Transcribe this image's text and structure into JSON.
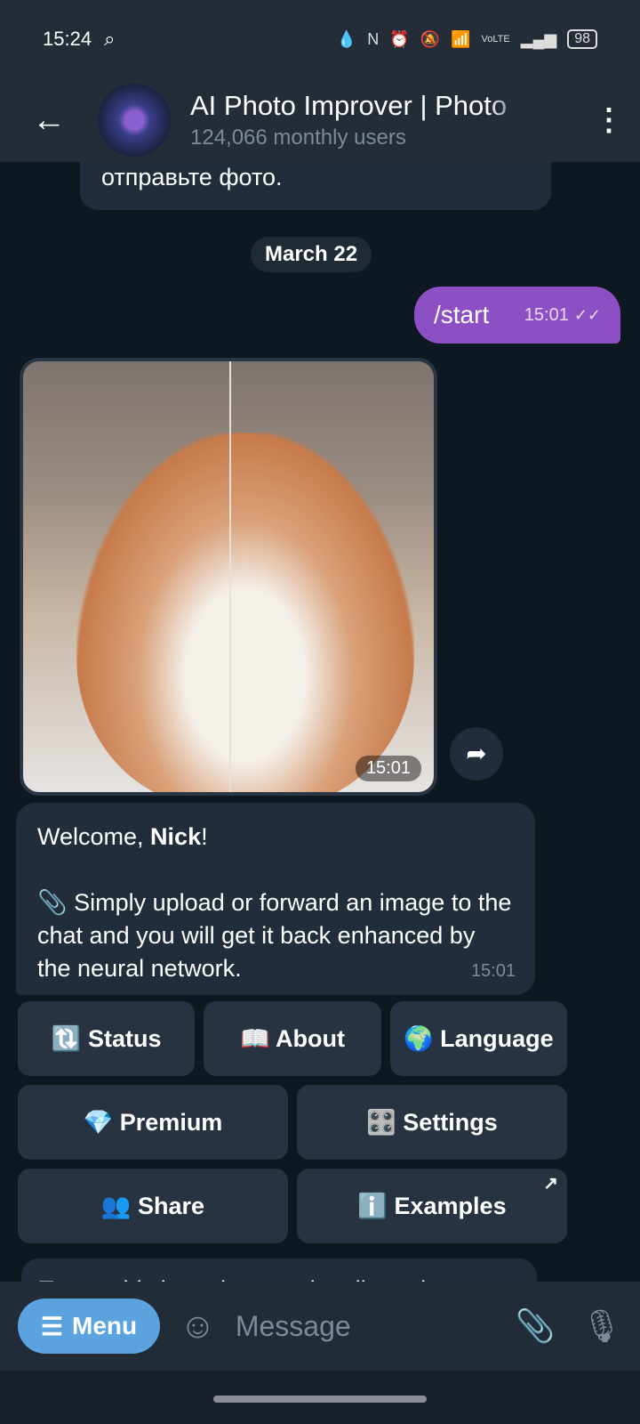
{
  "status_bar": {
    "time": "15:24",
    "battery": "98"
  },
  "header": {
    "title": "AI Photo Improver | Photo",
    "subtitle": "124,066 monthly users"
  },
  "chat": {
    "previous_message": "отправьте фото.",
    "date_chip": "March 22",
    "outgoing": {
      "text": "/start",
      "time": "15:01"
    },
    "photo": {
      "time": "15:01"
    },
    "welcome": {
      "greeting": "Welcome, ",
      "name": "Nick",
      "exclaim": "!",
      "body": "📎 Simply upload or forward an image to the chat and you will get it back enhanced by the neural network.",
      "time": "15:01"
    },
    "keyboard": [
      [
        {
          "label": "🔃 Status"
        },
        {
          "label": "📖 About"
        },
        {
          "label": "🌍 Language"
        }
      ],
      [
        {
          "label": "💎 Premium"
        },
        {
          "label": "🎛️ Settings"
        }
      ],
      [
        {
          "label": "👥 Share"
        },
        {
          "label": "ℹ️ Examples"
        }
      ]
    ],
    "next_message": "To use this bot, please subscribe to its"
  },
  "composer": {
    "menu_label": "Menu",
    "placeholder": "Message"
  }
}
